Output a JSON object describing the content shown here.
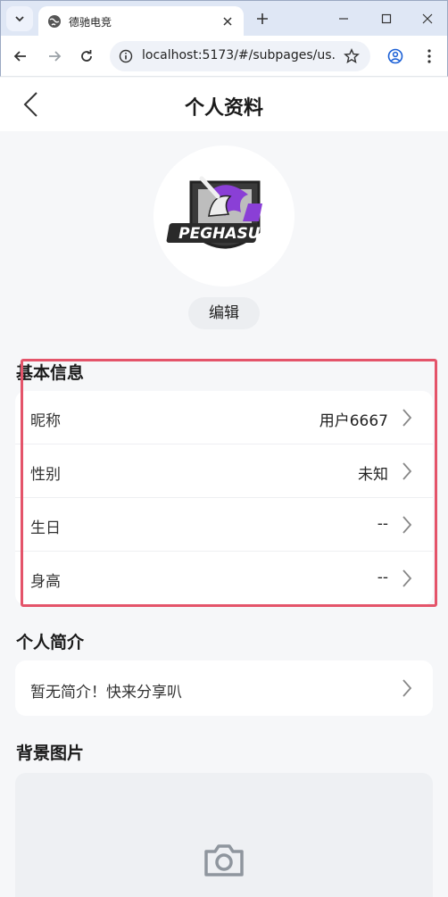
{
  "browser": {
    "tab_title": "德驰电竞",
    "url": "localhost:5173/#/subpages/us..."
  },
  "header": {
    "title": "个人资料"
  },
  "avatar": {
    "edit_label": "编辑",
    "logo_text": "PEGHASUS"
  },
  "basic_info": {
    "title": "基本信息",
    "rows": [
      {
        "label": "昵称",
        "value": "用户6667"
      },
      {
        "label": "性别",
        "value": "未知"
      },
      {
        "label": "生日",
        "value": "--"
      },
      {
        "label": "身高",
        "value": "--"
      }
    ]
  },
  "bio": {
    "title": "个人简介",
    "text": "暂无简介！快来分享叭"
  },
  "background": {
    "title": "背景图片"
  },
  "colors": {
    "highlight": "#e4546a",
    "page_bg": "#f6f7f9",
    "logo_purple": "#8a3fd6"
  }
}
